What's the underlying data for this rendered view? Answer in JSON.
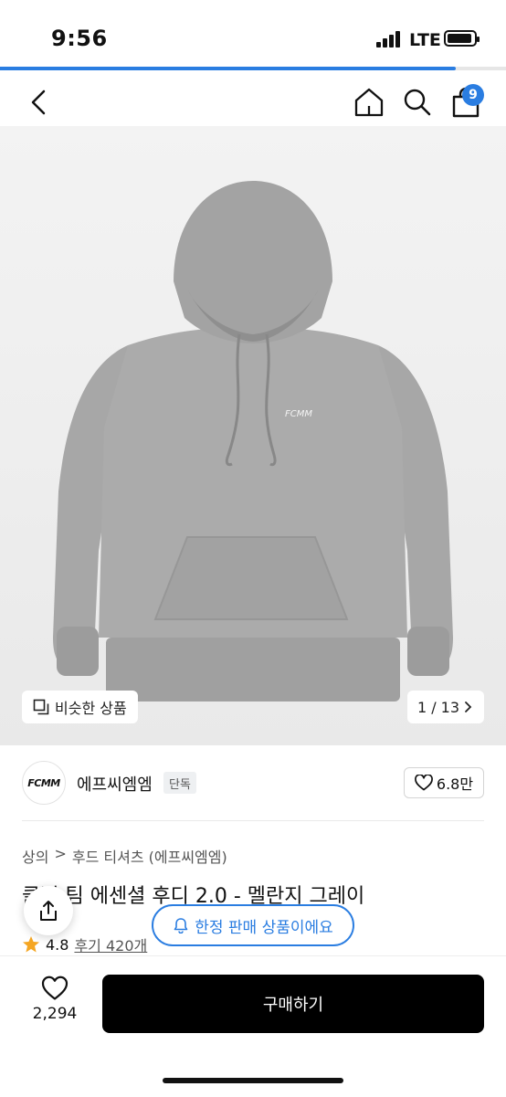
{
  "status_bar": {
    "time": "9:56",
    "network": "LTE"
  },
  "page_progress": 0.9,
  "header": {
    "cart_count": "9"
  },
  "gallery": {
    "similar_label": "비슷한 상품",
    "pager_text": "1 / 13",
    "garment_print": "FCMM"
  },
  "brand": {
    "logo_text": "FCMM",
    "name": "에프씨엠엠",
    "badge": "단독",
    "likes": "6.8만"
  },
  "breadcrumb": {
    "category": "상의",
    "separator": ">",
    "subcategory": "후드 티셔츠 (에프씨엠엠)"
  },
  "product": {
    "title": "클럽 팀 에센셜 후디 2.0 - 멜란지 그레이",
    "rating": "4.8",
    "reviews": "후기 420개"
  },
  "limited_notice": "한정 판매 상품이에요",
  "bottom_bar": {
    "like_count": "2,294",
    "buy_label": "구매하기"
  },
  "colors": {
    "accent": "#2a7de1",
    "buy_button": "#000000",
    "star": "#f5a623",
    "garment": "#a9a9a9"
  }
}
